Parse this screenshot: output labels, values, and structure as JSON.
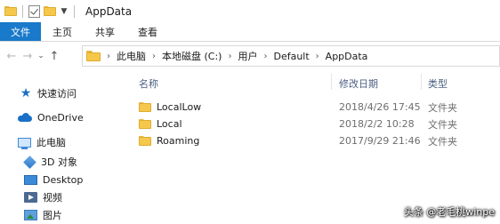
{
  "window": {
    "title": "AppData"
  },
  "ribbon": {
    "tabs": [
      {
        "label": "文件"
      },
      {
        "label": "主页"
      },
      {
        "label": "共享"
      },
      {
        "label": "查看"
      }
    ]
  },
  "address": {
    "crumbs": [
      "此电脑",
      "本地磁盘 (C:)",
      "用户",
      "Default",
      "AppData"
    ]
  },
  "sidebar": {
    "items": [
      {
        "label": "快速访问",
        "icon": "star-icon"
      },
      {
        "label": "OneDrive",
        "icon": "onedrive-cloud-icon"
      },
      {
        "label": "此电脑",
        "icon": "computer-icon"
      },
      {
        "label": "3D 对象",
        "icon": "3d-objects-icon"
      },
      {
        "label": "Desktop",
        "icon": "desktop-icon"
      },
      {
        "label": "视频",
        "icon": "video-icon"
      },
      {
        "label": "图片",
        "icon": "pictures-icon"
      }
    ]
  },
  "columns": {
    "name": "名称",
    "date": "修改日期",
    "type": "类型"
  },
  "files": [
    {
      "name": "LocalLow",
      "date": "2018/4/26 17:45",
      "type": "文件夹"
    },
    {
      "name": "Local",
      "date": "2018/2/2 10:28",
      "type": "文件夹"
    },
    {
      "name": "Roaming",
      "date": "2017/9/29 21:46",
      "type": "文件夹"
    }
  ],
  "watermark": "头条 @老毛桃winpe",
  "colors": {
    "file_tab": "#1979ca",
    "folder": "#f5c84c",
    "column_header": "#4d6082"
  }
}
